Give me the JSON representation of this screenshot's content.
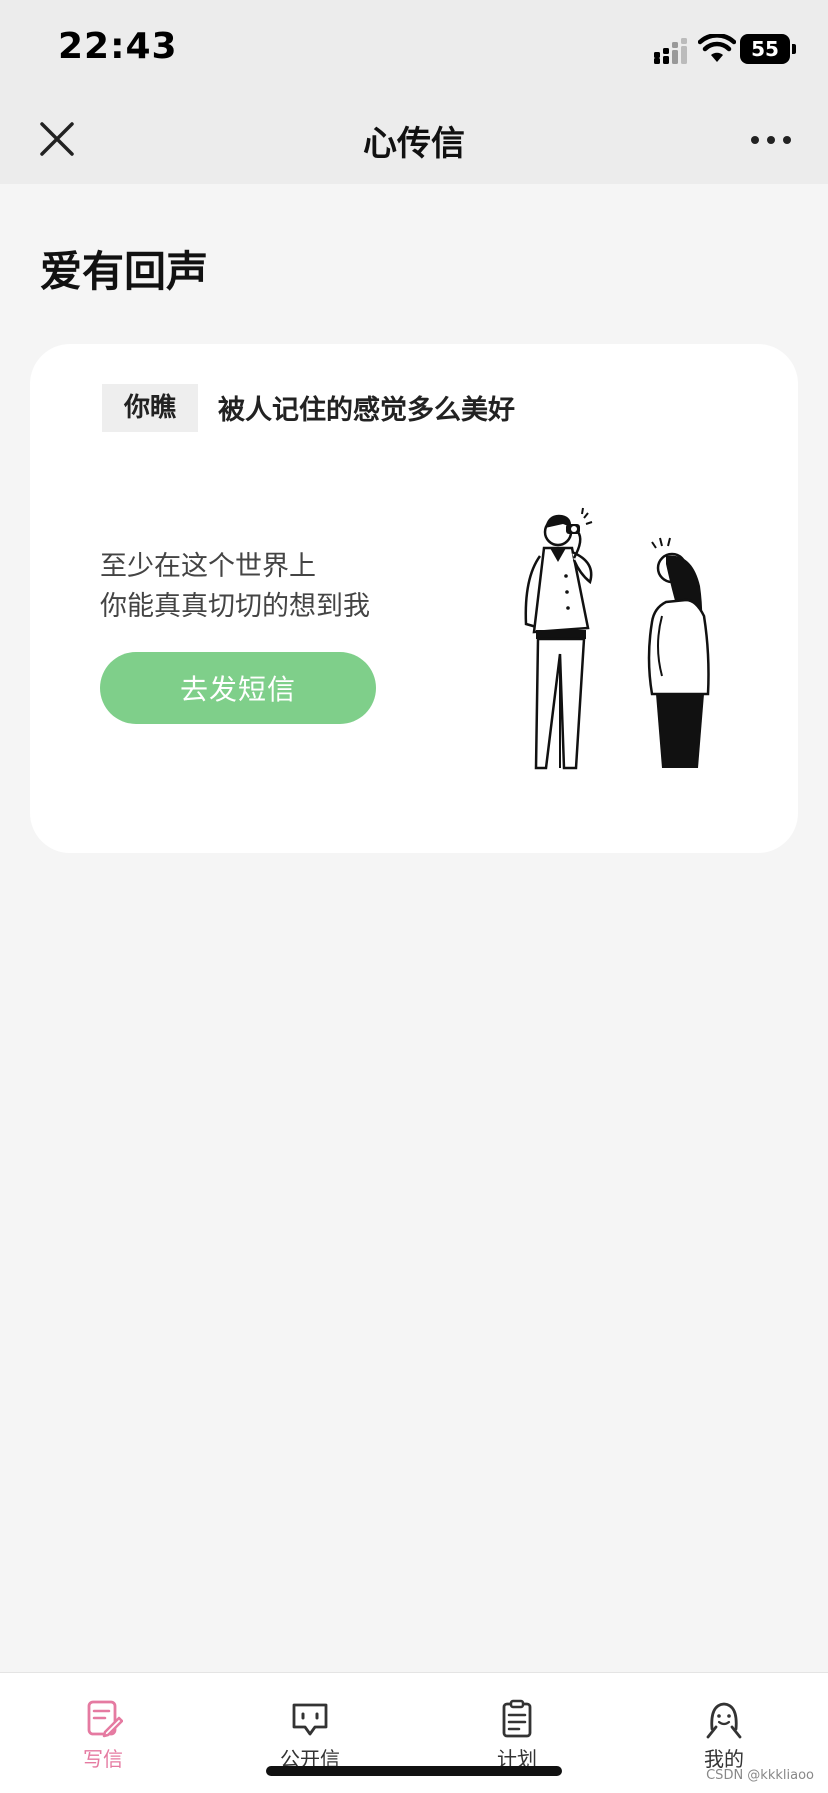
{
  "status_bar": {
    "time": "22:43",
    "battery": "55",
    "signal_icon": "signal-icon",
    "wifi_icon": "wifi-icon"
  },
  "nav": {
    "title": "心传信",
    "close_icon": "close-icon",
    "more_icon": "more-icon"
  },
  "section": {
    "title": "爱有回声"
  },
  "card": {
    "tag": "你瞧",
    "tagline": "被人记住的感觉多么美好",
    "body_lines": [
      "至少在这个世界上",
      "你能真真切切的想到我"
    ],
    "button_label": "去发短信",
    "illustration_icon": "couple-photo-illustration"
  },
  "tabbar": {
    "tabs": [
      {
        "label": "写信",
        "icon": "write-letter-icon",
        "active": true
      },
      {
        "label": "公开信",
        "icon": "message-bubble-icon",
        "active": false
      },
      {
        "label": "计划",
        "icon": "clipboard-icon",
        "active": false
      },
      {
        "label": "我的",
        "icon": "profile-icon",
        "active": false
      }
    ]
  },
  "watermark": "CSDN @kkkliaoo",
  "colors": {
    "accent_green": "#7fcf8a",
    "active_tab_pink": "#e57aa1",
    "background": "#f5f5f5",
    "topbar": "#ececec"
  }
}
